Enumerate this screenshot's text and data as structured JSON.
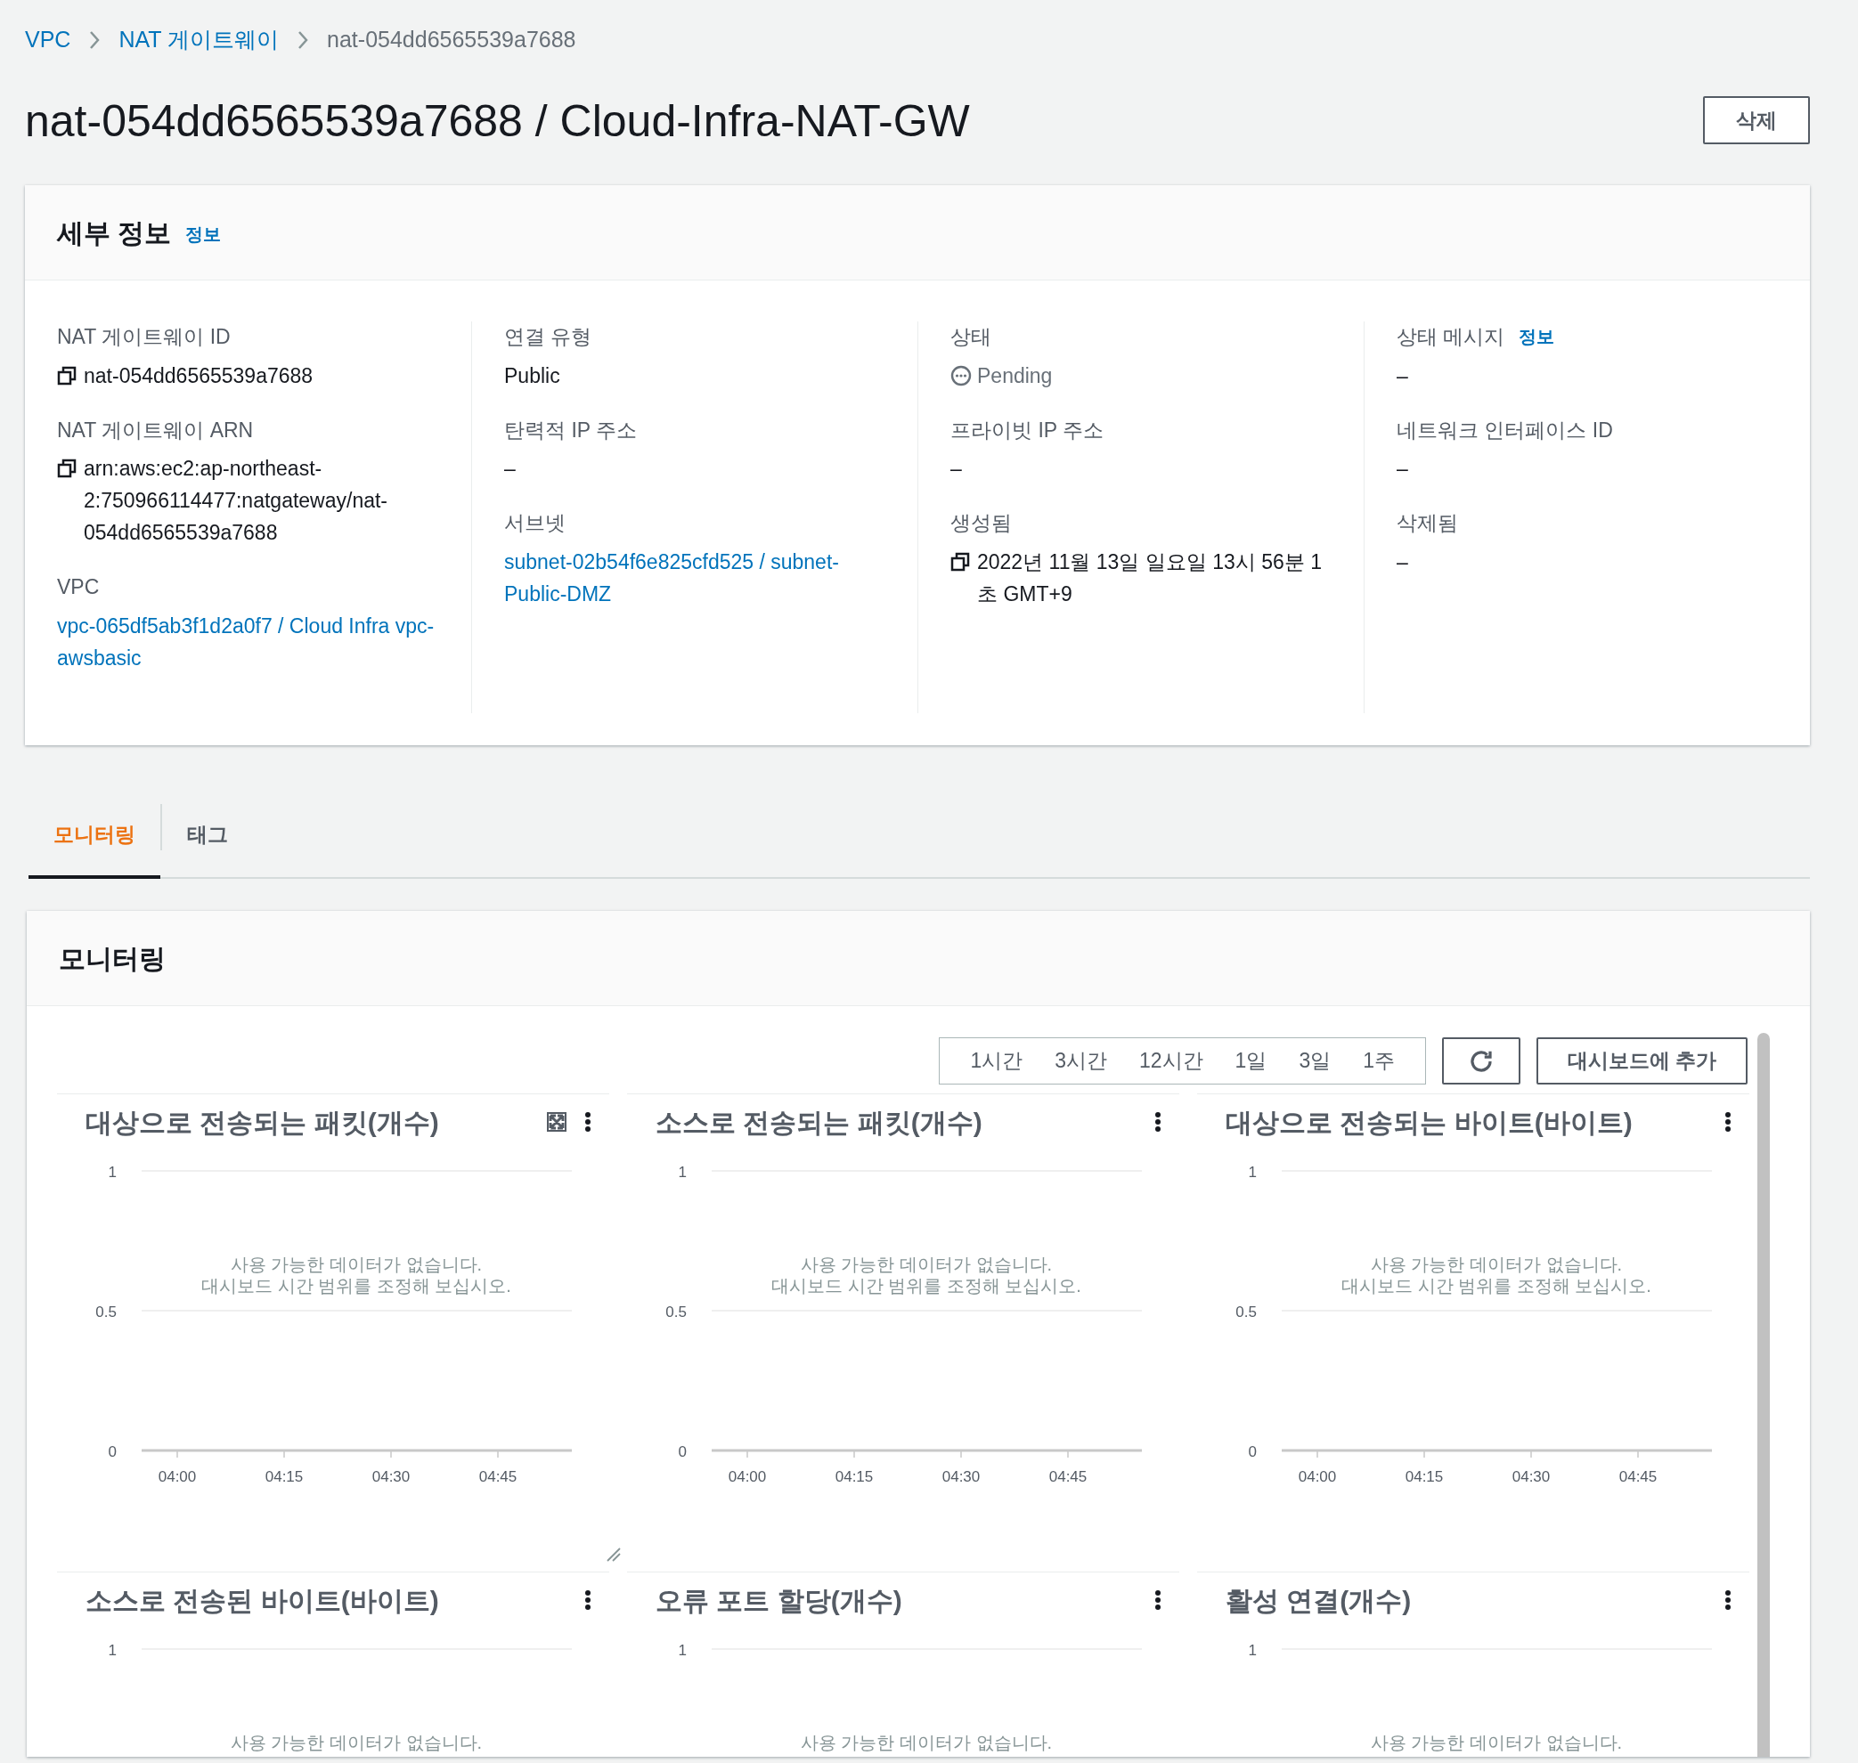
{
  "breadcrumb": [
    {
      "label": "VPC",
      "kind": "link"
    },
    {
      "label": "NAT 게이트웨이",
      "kind": "link"
    },
    {
      "label": "nat-054dd6565539a7688",
      "kind": "current"
    }
  ],
  "page_title": "nat-054dd6565539a7688 / Cloud-Infra-NAT-GW",
  "delete_button": "삭제",
  "details": {
    "title": "세부 정보",
    "info_link": "정보",
    "columns": [
      [
        {
          "label": "NAT 게이트웨이 ID",
          "kind": "copy",
          "value": "nat-054dd6565539a7688"
        },
        {
          "label": "NAT 게이트웨이 ARN",
          "kind": "copy",
          "value": "arn:aws:ec2:ap-northeast-2:750966114477:natgateway/nat-054dd6565539a7688"
        },
        {
          "label": "VPC",
          "kind": "link",
          "value": "vpc-065df5ab3f1d2a0f7 / Cloud Infra vpc-awsbasic"
        }
      ],
      [
        {
          "label": "연결 유형",
          "kind": "text",
          "value": "Public"
        },
        {
          "label": "탄력적 IP 주소",
          "kind": "text",
          "value": "–"
        },
        {
          "label": "서브넷",
          "kind": "link",
          "value": "subnet-02b54f6e825cfd525 / subnet-Public-DMZ"
        }
      ],
      [
        {
          "label": "상태",
          "kind": "status",
          "value": "Pending"
        },
        {
          "label": "프라이빗 IP 주소",
          "kind": "text",
          "value": "–"
        },
        {
          "label": "생성됨",
          "kind": "copy",
          "value": "2022년 11월 13일 일요일 13시 56분 1초 GMT+9"
        }
      ],
      [
        {
          "label": "상태 메시지",
          "info_link": "정보",
          "kind": "text",
          "value": "–"
        },
        {
          "label": "네트워크 인터페이스 ID",
          "kind": "text",
          "value": "–"
        },
        {
          "label": "삭제됨",
          "kind": "text",
          "value": "–"
        }
      ]
    ]
  },
  "tabs": [
    {
      "label": "모니터링",
      "selected": true
    },
    {
      "label": "태그",
      "selected": false
    }
  ],
  "monitoring": {
    "title": "모니터링",
    "time_ranges": [
      {
        "label": "1시간",
        "selected": false
      },
      {
        "label": "3시간",
        "selected": false
      },
      {
        "label": "12시간",
        "selected": false
      },
      {
        "label": "1일",
        "selected": false
      },
      {
        "label": "3일",
        "selected": false
      },
      {
        "label": "1주",
        "selected": false
      }
    ],
    "add_to_dashboard": "대시보드에 추가",
    "widgets": [
      {
        "title": "대상으로 전송되는 패킷(개수)",
        "hovered": true,
        "message": [
          "사용 가능한 데이터가 없습니다.",
          "대시보드 시간 범위를 조정해 보십시오."
        ],
        "chart_data": {
          "type": "line",
          "ylim": [
            0,
            1
          ],
          "yticks": [
            0,
            0.5,
            1
          ],
          "categories": [
            "04:00",
            "04:15",
            "04:30",
            "04:45"
          ]
        }
      },
      {
        "title": "소스로 전송되는 패킷(개수)",
        "hovered": false,
        "message": [
          "사용 가능한 데이터가 없습니다.",
          "대시보드 시간 범위를 조정해 보십시오."
        ],
        "chart_data": {
          "type": "line",
          "ylim": [
            0,
            1
          ],
          "yticks": [
            0,
            0.5,
            1
          ],
          "categories": [
            "04:00",
            "04:15",
            "04:30",
            "04:45"
          ]
        }
      },
      {
        "title": "대상으로 전송되는 바이트(바이트)",
        "hovered": false,
        "message": [
          "사용 가능한 데이터가 없습니다.",
          "대시보드 시간 범위를 조정해 보십시오."
        ],
        "chart_data": {
          "type": "line",
          "ylim": [
            0,
            1
          ],
          "yticks": [
            0,
            0.5,
            1
          ],
          "categories": [
            "04:00",
            "04:15",
            "04:30",
            "04:45"
          ]
        }
      },
      {
        "title": "소스로 전송된 바이트(바이트)",
        "hovered": false,
        "message": [
          "사용 가능한 데이터가 없습니다."
        ],
        "axis_label": "1"
      },
      {
        "title": "오류 포트 할당(개수)",
        "hovered": false,
        "message": [
          "사용 가능한 데이터가 없습니다."
        ],
        "axis_label": "1"
      },
      {
        "title": "활성 연결(개수)",
        "hovered": false,
        "message": [
          "사용 가능한 데이터가 없습니다."
        ],
        "axis_label": "1"
      }
    ]
  }
}
